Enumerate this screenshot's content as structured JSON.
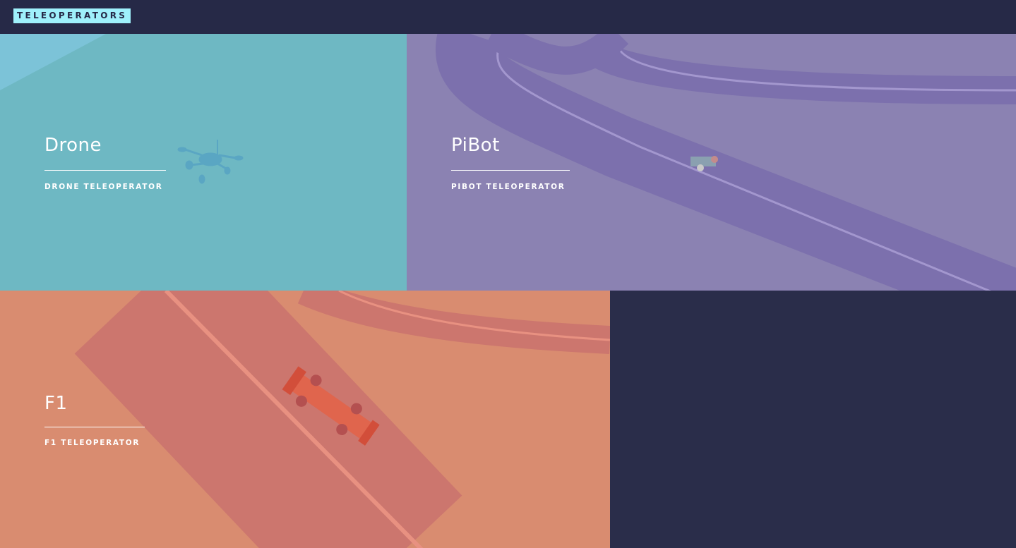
{
  "header": {
    "logo_text": "TELEOPERATORS"
  },
  "tiles": [
    {
      "title": "Drone",
      "subtitle": "DRONE TELEOPERATOR",
      "color": "#6eb8c3"
    },
    {
      "title": "PiBot",
      "subtitle": "PIBOT TELEOPERATOR",
      "color": "#8b82b2"
    },
    {
      "title": "F1",
      "subtitle": "F1 TELEOPERATOR",
      "color": "#d98c70"
    }
  ],
  "colors": {
    "header_bg": "#262947",
    "page_bg": "#2a2d4a",
    "logo_bg": "#9ff0fb"
  }
}
